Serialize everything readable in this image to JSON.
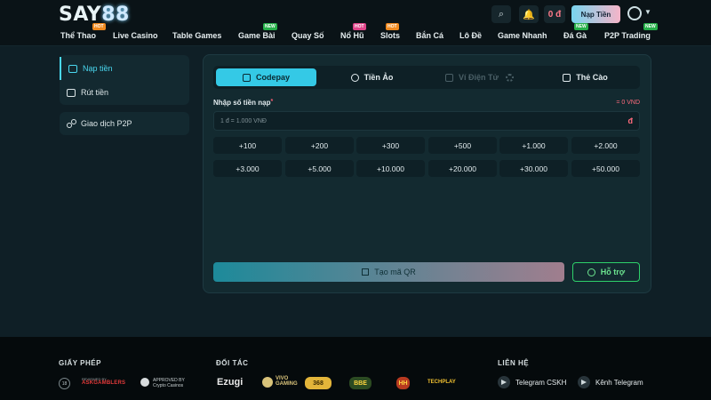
{
  "brand": {
    "logo_prefix": "SAY",
    "logo_suffix": "88"
  },
  "header": {
    "search_icon": "⌕",
    "bell_icon": "🔔",
    "balance": "0 đ",
    "deposit_label": "Nạp Tiền"
  },
  "nav": {
    "items": [
      {
        "label": "Thể Thao",
        "badge": "HOT"
      },
      {
        "label": "Live Casino",
        "badge": ""
      },
      {
        "label": "Table Games",
        "badge": ""
      },
      {
        "label": "Game Bài",
        "badge": "NEW"
      },
      {
        "label": "Quay Số",
        "badge": ""
      },
      {
        "label": "Nổ Hũ",
        "badge": "HOT"
      },
      {
        "label": "Slots",
        "badge": "HOT"
      },
      {
        "label": "Bắn Cá",
        "badge": ""
      },
      {
        "label": "Lô Đề",
        "badge": ""
      },
      {
        "label": "Game Nhanh",
        "badge": ""
      },
      {
        "label": "Đá Gà",
        "badge": "NEW"
      },
      {
        "label": "P2P Trading",
        "badge": "NEW"
      }
    ]
  },
  "sidebar": {
    "items": [
      {
        "label": "Nạp tiền"
      },
      {
        "label": "Rút tiền"
      }
    ],
    "p2p_label": "Giao dịch P2P"
  },
  "deposit": {
    "tabs": [
      {
        "label": "Codepay"
      },
      {
        "label": "Tiền Ảo"
      },
      {
        "label": "Ví Điện Tử"
      },
      {
        "label": "Thẻ Cào"
      }
    ],
    "amount_label": "Nhập số tiền nạp",
    "required_mark": "*",
    "amount_summary": "= 0 VND",
    "input_placeholder": "1 đ = 1.000 VNĐ",
    "currency_symbol": "đ",
    "presets": [
      "+100",
      "+200",
      "+300",
      "+500",
      "+1.000",
      "+2.000",
      "+3.000",
      "+5.000",
      "+10.000",
      "+20.000",
      "+30.000",
      "+50.000"
    ],
    "qr_label": "Tạo mã QR",
    "help_label": "Hỗ trợ"
  },
  "footer": {
    "license_title": "GIẤY PHÉP",
    "license_18": "18",
    "askgamblers_top": "REVIEWED BY",
    "askgamblers_name": "ASKGAMBLERS",
    "crypto_top": "APPROVED BY",
    "crypto_name": "Crypto Casinos",
    "partners_title": "ĐỐI TÁC",
    "partners": {
      "ezugi": "Ezugi",
      "vivo": "VIVO GAMING",
      "p368": "368",
      "bbe": "BBE",
      "hh": "HH",
      "techplay": "TECHPLAY"
    },
    "contact_title": "LIÊN HỆ",
    "telegram_cskh": "Telegram CSKH",
    "telegram_channel": "Kênh Telegram"
  }
}
